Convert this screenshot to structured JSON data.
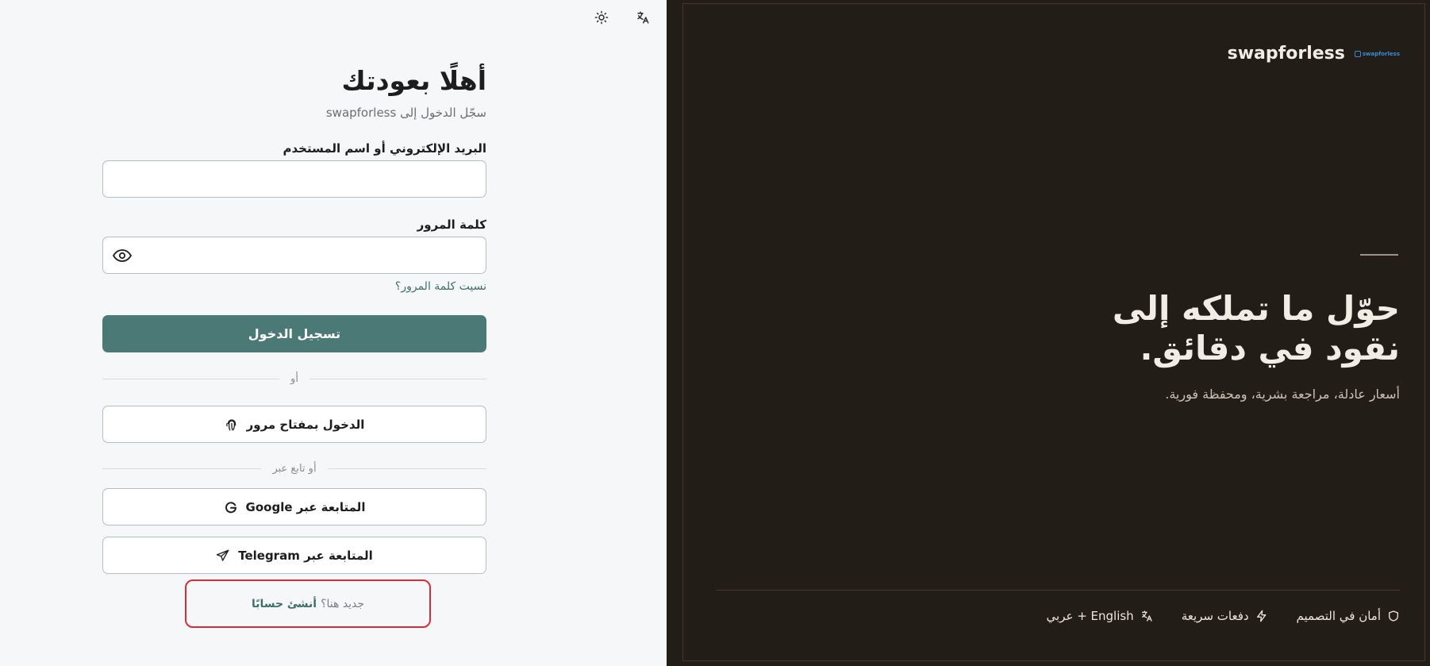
{
  "header": {
    "theme_toggle_icon": "sun-icon",
    "language_icon": "translate-icon"
  },
  "login": {
    "title": "أهلًا بعودتك",
    "subtitle": "سجّل الدخول إلى swapforless",
    "email_label": "البريد الإلكتروني أو اسم المستخدم",
    "email_value": "",
    "email_placeholder": "",
    "password_label": "كلمة المرور",
    "password_value": "",
    "password_placeholder": "",
    "forgot_password": "نسيت كلمة المرور؟",
    "submit_label": "تسجيل الدخول",
    "divider_or": "أو",
    "passkey_label": "الدخول بمفتاح مرور",
    "divider_continue": "أو تابع عبر",
    "google_label": "المتابعة عبر Google",
    "telegram_label": "المتابعة عبر Telegram",
    "signup_question": "جديد هنا؟",
    "signup_link": "أنشئ حسابًا"
  },
  "promo": {
    "brand_name": "swapforless",
    "brand_logo_text": "swapforless",
    "hero_line1": "حوّل ما تملكه إلى",
    "hero_line2": "نقود في دقائق.",
    "hero_subtitle": "أسعار عادلة، مراجعة بشرية، ومحفظة فورية.",
    "features": [
      {
        "icon": "shield-icon",
        "label": "أمان في التصميم"
      },
      {
        "icon": "lightning-icon",
        "label": "دفعات سريعة"
      },
      {
        "icon": "translate-icon",
        "label": "English + عربي"
      }
    ]
  },
  "colors": {
    "primary": "#4b7a76",
    "dark_panel": "#221d17",
    "highlight_border": "#d62c3a"
  }
}
